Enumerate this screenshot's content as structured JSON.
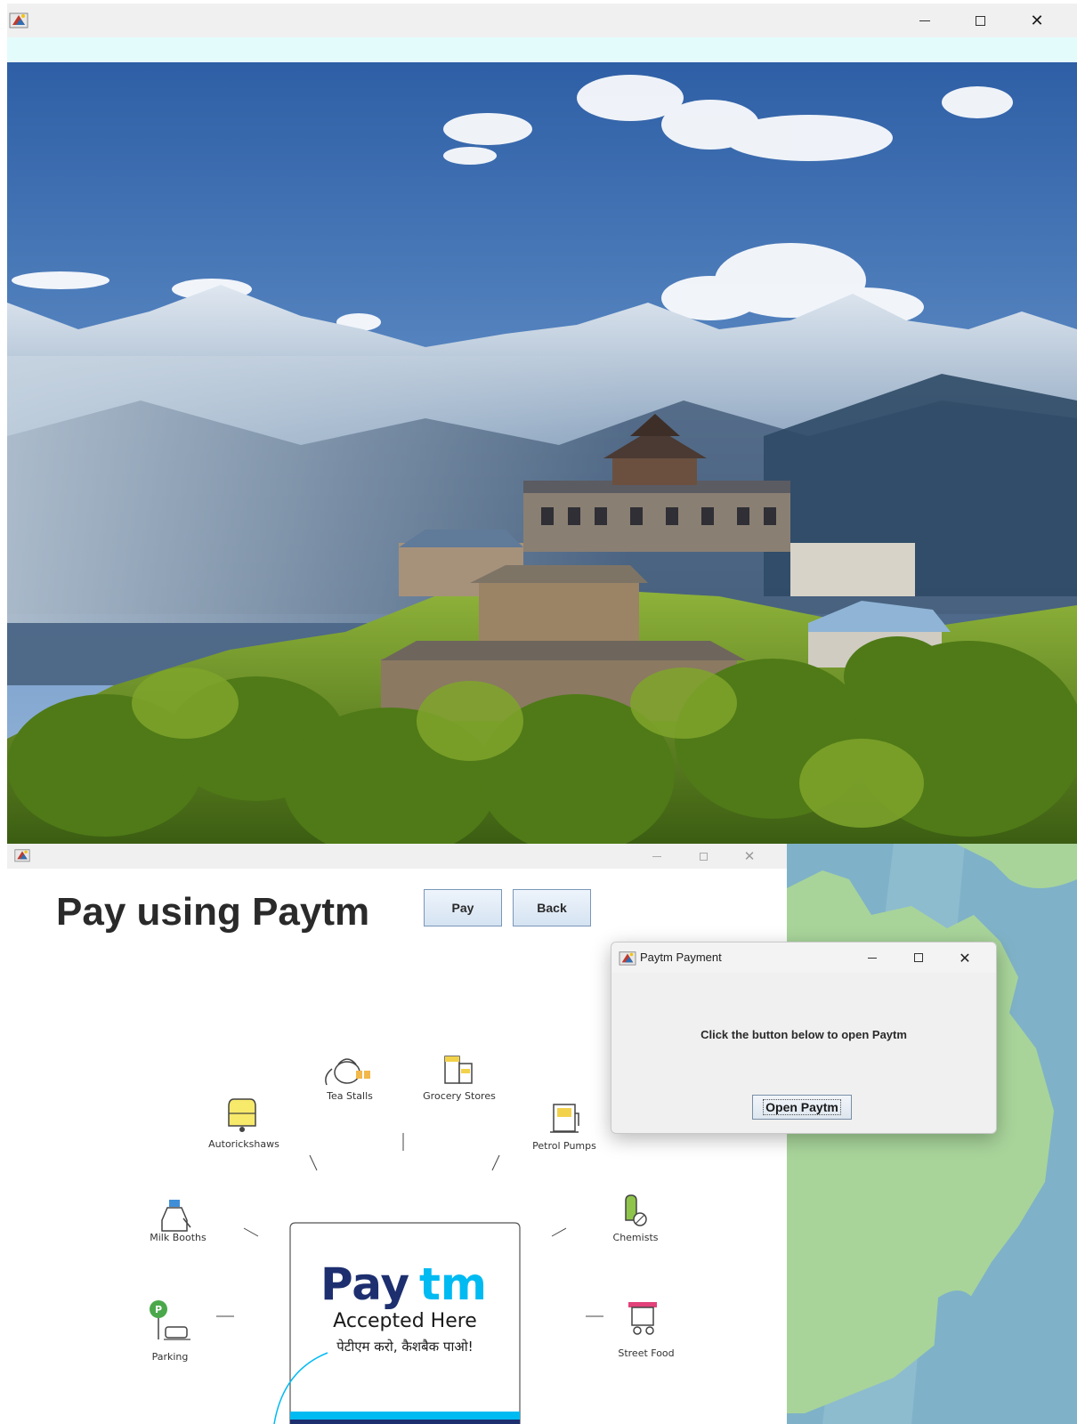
{
  "main_window": {
    "icon": "java-app-icon",
    "controls": [
      "minimize-icon",
      "maximize-icon",
      "close-icon"
    ],
    "close_glyph": "✕",
    "background_image": "mountain-village-landscape"
  },
  "payment_window": {
    "heading": "Pay using Paytm",
    "pay_button": "Pay",
    "back_button": "Back",
    "close_glyph": "✕",
    "poster": {
      "brand_pay": "Pay",
      "brand_tm": "tm",
      "accepted": "Accepted Here",
      "hindi_tagline": "पेटीएम करो, कैशबैक पाओ!",
      "categories": [
        {
          "label": "Tea Stalls",
          "icon": "kettle-icon"
        },
        {
          "label": "Grocery Stores",
          "icon": "jars-icon"
        },
        {
          "label": "Autorickshaws",
          "icon": "autorickshaw-icon"
        },
        {
          "label": "Petrol Pumps",
          "icon": "fuel-pump-icon"
        },
        {
          "label": "Milk Booths",
          "icon": "milk-bottle-icon"
        },
        {
          "label": "Chemists",
          "icon": "pill-icon"
        },
        {
          "label": "Parking",
          "icon": "parking-icon"
        },
        {
          "label": "Street Food",
          "icon": "food-cart-icon"
        }
      ]
    }
  },
  "dialog": {
    "title": "Paytm Payment",
    "message": "Click the button below to open Paytm",
    "button": "Open Paytm",
    "close_glyph": "✕"
  },
  "colors": {
    "paytm_navy": "#1d2f6f",
    "paytm_cyan": "#00baf2",
    "window_chrome": "#f0f0f0",
    "title_strip": "#e4fbfb"
  }
}
